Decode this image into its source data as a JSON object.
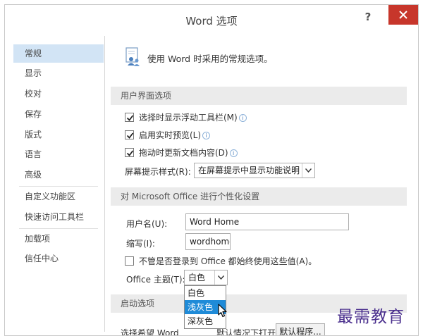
{
  "window": {
    "title": "Word 选项",
    "help_label": "?"
  },
  "sidebar": {
    "items": [
      {
        "label": "常规",
        "active": true
      },
      {
        "label": "显示"
      },
      {
        "label": "校对"
      },
      {
        "label": "保存"
      },
      {
        "label": "版式"
      },
      {
        "label": "语言"
      },
      {
        "label": "高级"
      },
      {
        "label": "自定义功能区"
      },
      {
        "label": "快速访问工具栏"
      },
      {
        "label": "加载项"
      },
      {
        "label": "信任中心"
      }
    ]
  },
  "intro": {
    "text": "使用 Word 时采用的常规选项。",
    "icon": "people-settings-icon"
  },
  "ui_options": {
    "header": "用户界面选项",
    "mini_toolbar_label": "选择时显示浮动工具栏(M)",
    "mini_toolbar_checked": true,
    "live_preview_label": "启用实时预览(L)",
    "live_preview_checked": true,
    "update_content_label": "拖动时更新文档内容(D)",
    "update_content_checked": true,
    "screentip_label": "屏幕提示样式(R):",
    "screentip_value": "在屏幕提示中显示功能说明",
    "info_glyph": "i"
  },
  "personalize": {
    "header": "对 Microsoft Office 进行个性化设置",
    "username_label": "用户名(U):",
    "username_value": "Word Home",
    "initials_label": "缩写(I):",
    "initials_value": "wordhome",
    "always_use_label": "不管是否登录到 Office 都始终使用这些值(A)。",
    "always_use_checked": false,
    "theme_label": "Office 主题(T):",
    "theme_value": "白色",
    "theme_options": [
      "白色",
      "浅灰色",
      "深灰色"
    ],
    "theme_hover_index": 1
  },
  "startup": {
    "header": "启动选项",
    "default_programs_label_left": "选择希望 Word",
    "default_programs_label_right": "默认情况下打开扩展名:",
    "default_programs_button": "默认程序..."
  },
  "watermark": {
    "text": "最需教育"
  },
  "colors": {
    "accent": "#1f8bd8",
    "close": "#c7362b",
    "sidebar_active": "#d2e4f5",
    "section_bg": "#ebebeb"
  }
}
